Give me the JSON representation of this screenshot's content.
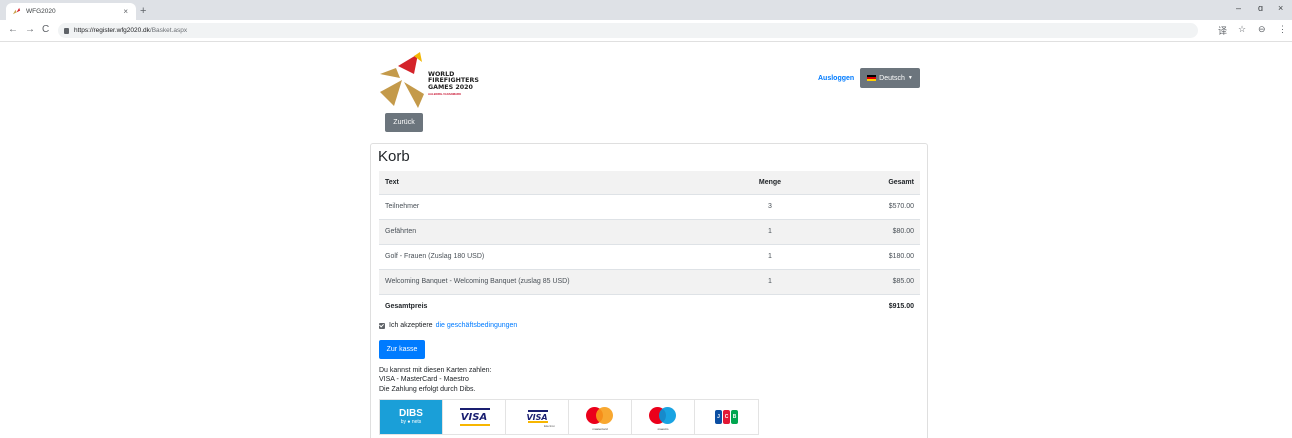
{
  "browser": {
    "tab_title": "WFG2020",
    "tab_close": "×",
    "new_tab": "+",
    "url_host": "https://register.wfg2020.dk",
    "url_path": "/Basket.aspx",
    "nav_back": "←",
    "nav_forward": "→",
    "nav_reload": "C",
    "win_minimize": "–",
    "win_maximize": "ɑ",
    "win_close": "×",
    "translate_icon": "译",
    "star_icon": "☆",
    "profile_icon": "⊖",
    "menu_icon": "⋮"
  },
  "header": {
    "logo_lines": [
      "WORLD",
      "FIREFIGHTERS",
      "GAMES 2020"
    ],
    "logo_sub": "AALBORG-VI-DANMARK",
    "logout": "Ausloggen",
    "language": "Deutsch",
    "back_button": "Zurück"
  },
  "basket": {
    "title": "Korb",
    "columns": [
      "Text",
      "Menge",
      "Gesamt"
    ],
    "rows": [
      {
        "text": "Teilnehmer",
        "qty": "3",
        "total": "$570.00"
      },
      {
        "text": "Gefährten",
        "qty": "1",
        "total": "$80.00"
      },
      {
        "text": "Golf - Frauen (Zuslag 180 USD)",
        "qty": "1",
        "total": "$180.00"
      },
      {
        "text": "Welcoming Banquet - Welcoming Banquet (zuslag 85 USD)",
        "qty": "1",
        "total": "$85.00"
      }
    ],
    "total_label": "Gesamtpreis",
    "total_value": "$915.00",
    "terms_prefix": "Ich akzeptiere",
    "terms_link": "die geschäftsbedingungen",
    "checkout_button": "Zur kasse",
    "pay_lines": [
      "Du kannst mit diesen Karten zahlen:",
      "VISA - MasterCard - Maestro",
      "Die Zahlung erfolgt durch Dibs."
    ],
    "payment_cards": {
      "dibs": "DIBS",
      "dibs_sub": "by ● nets",
      "visa": "VISA",
      "visa_electron": "VISA",
      "visa_electron_sub": "Electron",
      "mastercard_label": "mastercard",
      "maestro_label": "maestro",
      "jcb": [
        "J",
        "C",
        "B"
      ]
    }
  },
  "colors": {
    "primary": "#007bff",
    "secondary": "#6c757d",
    "dibs": "#1a9fd8",
    "mc_red": "#eb001b",
    "mc_orange": "#ff5f00",
    "mc_yellow": "#f79e1b",
    "maestro_blue": "#0099df"
  }
}
